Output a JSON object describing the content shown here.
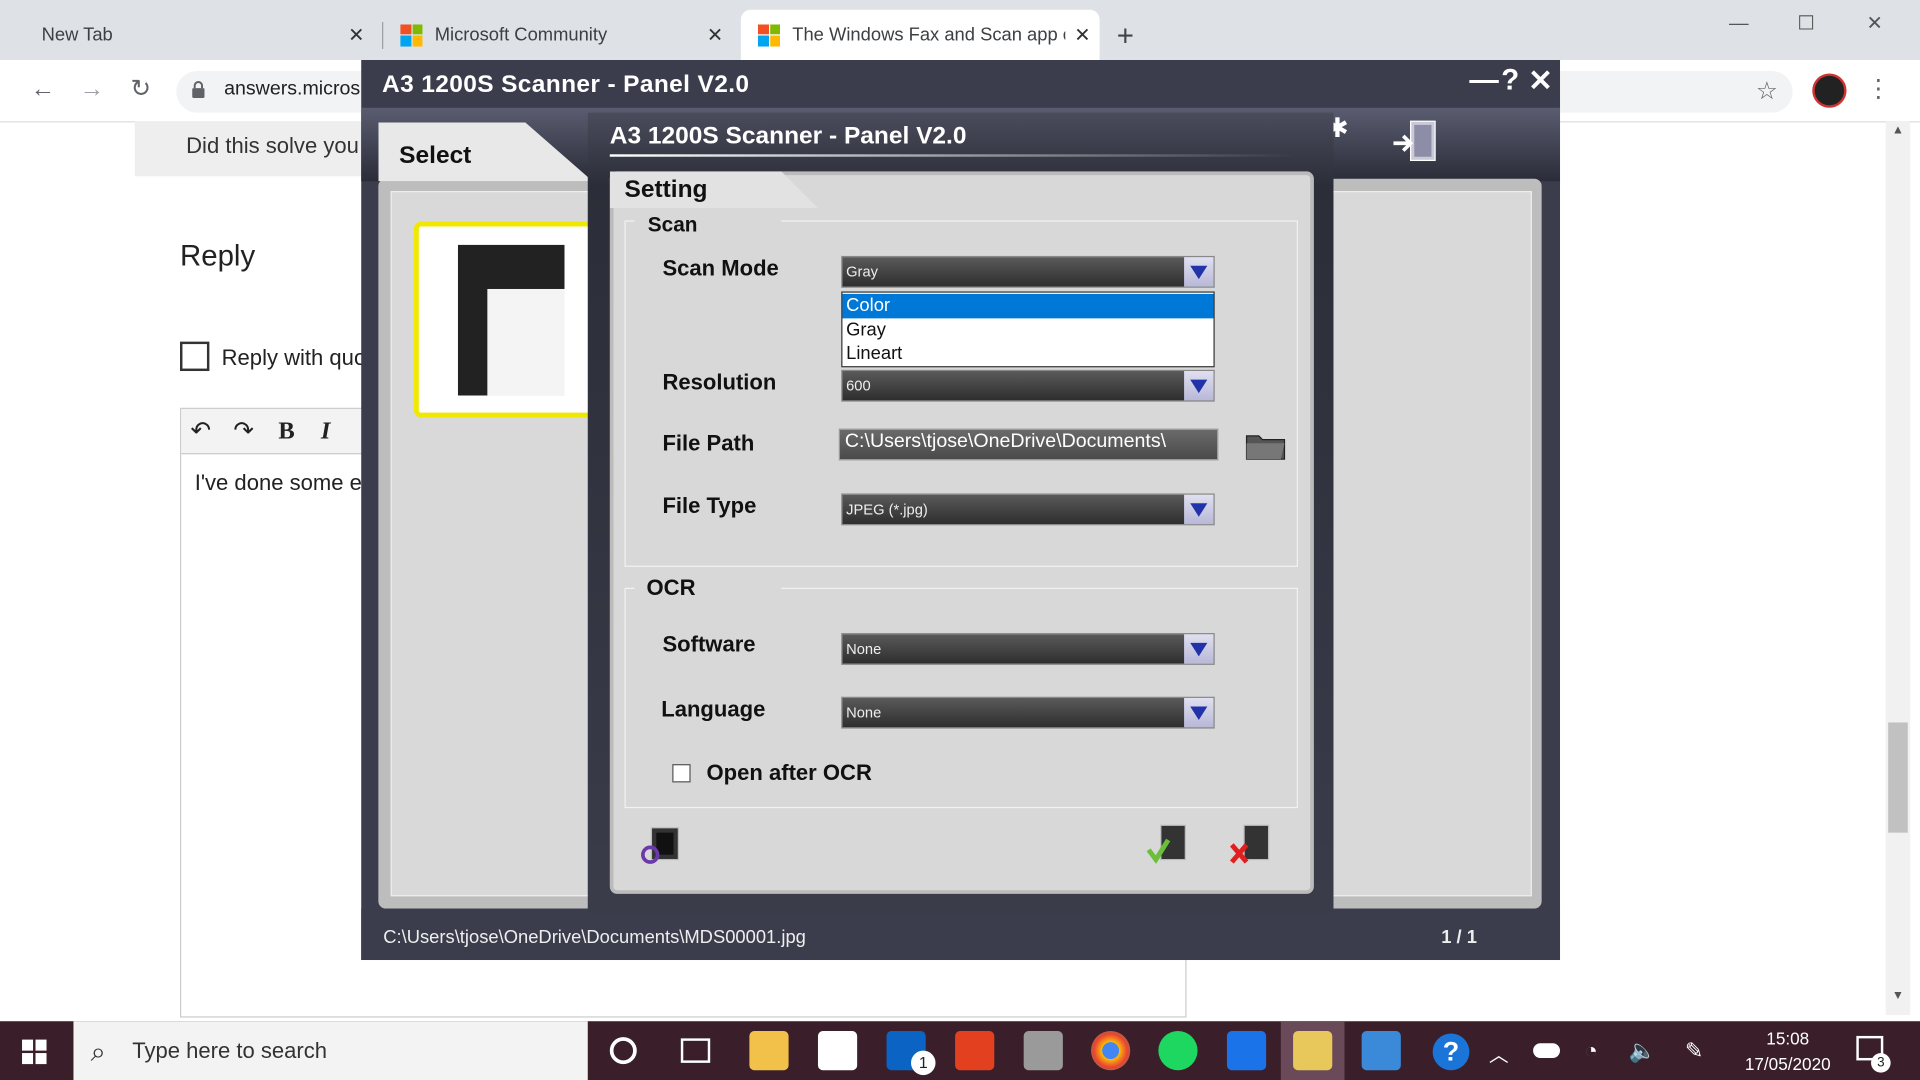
{
  "browser": {
    "tabs": [
      {
        "label": "New Tab"
      },
      {
        "label": "Microsoft Community"
      },
      {
        "label": "The Windows Fax and Scan app c"
      }
    ],
    "new_tab": "+",
    "url": "answers.micros",
    "window_controls": {
      "minimize": "—",
      "maximize": "☐",
      "close": "✕"
    }
  },
  "page": {
    "solve_question": "Did this solve you",
    "reply_heading": "Reply",
    "reply_with_quote": "Reply with quo",
    "editor_text": "I've done some e",
    "editor_buttons": {
      "undo": "↶",
      "redo": "↷",
      "bold": "B",
      "italic": "I"
    }
  },
  "outer_window": {
    "title": "A3 1200S Scanner - Panel V2.0",
    "controls": {
      "minimize": "—",
      "help": "?",
      "close": "✕"
    },
    "select_tab": "Select",
    "status_path": "C:\\Users\\tjose\\OneDrive\\Documents\\MDS00001.jpg",
    "page_indicator": "1 / 1"
  },
  "setting_dialog": {
    "title": "A3 1200S Scanner - Panel V2.0",
    "tab": "Setting",
    "scan_group": "Scan",
    "scan_mode_label": "Scan Mode",
    "scan_mode_value": "Gray",
    "scan_mode_options": [
      "Color",
      "Gray",
      "Lineart"
    ],
    "scan_mode_highlighted": "Color",
    "resolution_label": "Resolution",
    "resolution_value": "600",
    "file_path_label": "File Path",
    "file_path_value": "C:\\Users\\tjose\\OneDrive\\Documents\\",
    "file_type_label": "File Type",
    "file_type_value": "JPEG (*.jpg)",
    "ocr_group": "OCR",
    "software_label": "Software",
    "software_value": "None",
    "language_label": "Language",
    "language_value": "None",
    "open_after_ocr_label": "Open after OCR",
    "open_after_ocr_checked": false
  },
  "taskbar": {
    "search_placeholder": "Type here to search",
    "mail_badge": "1",
    "notification_badge": "3",
    "time": "15:08",
    "date": "17/05/2020"
  },
  "colors": {
    "taskbar": "#3a1f2a",
    "scanner_frame": "#3b3d4c",
    "selection_highlight": "#0078d7",
    "thumbnail_border": "#f0e800"
  }
}
